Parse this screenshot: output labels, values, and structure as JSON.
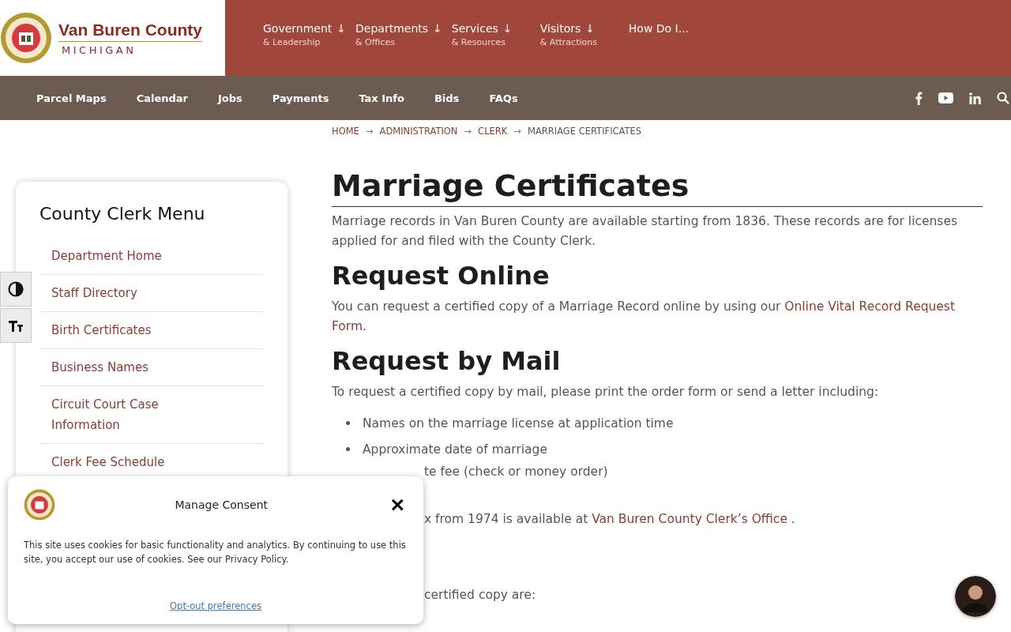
{
  "header": {
    "title": "Van Buren County",
    "subtitle": "MICHIGAN",
    "nav": [
      {
        "label": "Government",
        "sub": "& Leadership",
        "arrow": "↓"
      },
      {
        "label": "Departments",
        "sub": "& Offices",
        "arrow": "↓"
      },
      {
        "label": "Services",
        "sub": "& Resources",
        "arrow": "↓"
      },
      {
        "label": "Visitors",
        "sub": "& Attractions",
        "arrow": "↓"
      },
      {
        "label": "How Do I..."
      }
    ]
  },
  "subnav": {
    "links": [
      "Parcel Maps",
      "Calendar",
      "Jobs",
      "Payments",
      "Tax Info",
      "Bids",
      "FAQs"
    ]
  },
  "breadcrumb": [
    {
      "label": "HOME",
      "link": true
    },
    {
      "sep": "→",
      "label": "ADMINISTRATION",
      "link": true
    },
    {
      "sep": "→",
      "label": "CLERK",
      "link": true
    },
    {
      "sep": "→",
      "label": "MARRIAGE CERTIFICATES",
      "link": false
    }
  ],
  "sidebar": {
    "title": "County Clerk Menu",
    "items": [
      "Department Home",
      "Staff Directory",
      "Birth Certificates",
      "Business Names",
      "Circuit Court Case Information",
      "Clerk Fee Schedule"
    ]
  },
  "content": {
    "title": "Marriage Certificates",
    "blocks": [
      {
        "kind": "p",
        "text": "Marriage records in Van Buren County are available starting from 1836. These records are for licenses applied for and filed with the County Clerk."
      },
      {
        "kind": "h2",
        "text": "Request Online"
      },
      {
        "kind": "p",
        "text": "You can request a certified copy of a Marriage Record online by using our ",
        "links": [
          "Online Vital Record Request",
          "Form"
        ],
        "after": "."
      },
      {
        "kind": "h2",
        "text": "Request by Mail"
      },
      {
        "kind": "p",
        "text": "To request a certified copy by mail, please print the order form or send a letter including:"
      },
      {
        "kind": "li",
        "text": "Names on the marriage license at application time"
      },
      {
        "kind": "li",
        "text": "Approximate date of marriage"
      },
      {
        "kind": "partial",
        "text": "te fee (check or money order)"
      },
      {
        "kind": "partial",
        "text": "x from 1974 is available at ",
        "link": "Van Buren County Clerk’s Office",
        "after": " ."
      },
      {
        "kind": "partial",
        "text": "certified copy are:"
      }
    ]
  },
  "consent": {
    "title": "Manage Consent",
    "close": "×",
    "text": "This site uses cookies for basic functionality and analytics. By continuing to use this site, you accept our use of cookies. See our Privacy Policy.",
    "link": "Opt-out preferences"
  }
}
